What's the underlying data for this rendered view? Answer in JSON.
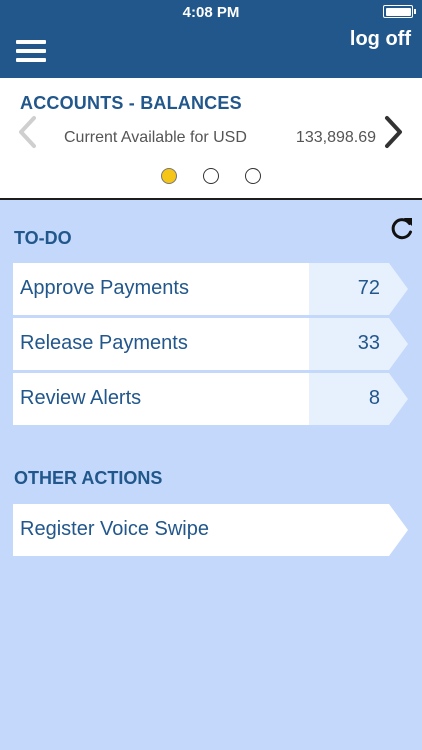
{
  "status_bar": {
    "time": "4:08 PM"
  },
  "header": {
    "logoff_label": "log off"
  },
  "accounts": {
    "title": "ACCOUNTS - BALANCES",
    "label": "Current Available for USD",
    "value": "133,898.69",
    "pages": 3,
    "active_page": 1
  },
  "todo": {
    "title": "TO-DO",
    "items": [
      {
        "label": "Approve Payments",
        "count": "72"
      },
      {
        "label": "Release Payments",
        "count": "33"
      },
      {
        "label": "Review Alerts",
        "count": "8"
      }
    ]
  },
  "other_actions": {
    "title": "OTHER ACTIONS",
    "items": [
      {
        "label": "Register Voice Swipe"
      }
    ]
  },
  "colors": {
    "header_bg": "#22578c",
    "page_bg": "#c3d8fb",
    "accent_text": "#22578c",
    "active_dot": "#f5c518",
    "count_bg": "#e7f0fd"
  }
}
